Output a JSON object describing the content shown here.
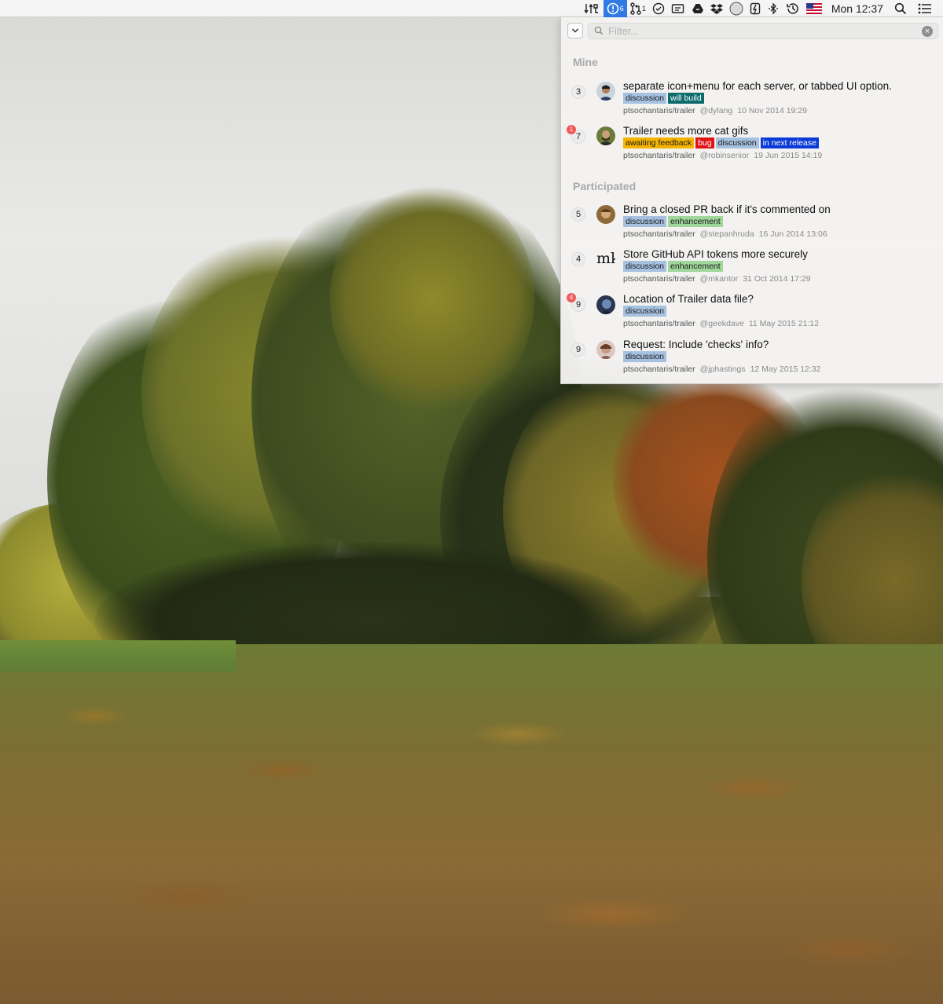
{
  "menubar": {
    "trailer_badge": "6",
    "pr_badge": "1",
    "clock": "Mon 12:37"
  },
  "filter": {
    "placeholder": "Filter..."
  },
  "sections": {
    "mine": "Mine",
    "participated": "Participated"
  },
  "items": [
    {
      "count": "3",
      "unread": "",
      "title": "separate icon+menu for each server, or tabbed UI option.",
      "labels": [
        {
          "text": "discussion",
          "color": "#a6c1e0",
          "fg": "#1b1b1b"
        },
        {
          "text": "will build",
          "color": "#0e6b6b",
          "fg": "#ffffff"
        }
      ],
      "repo": "ptsochantaris/trailer",
      "user": "@dylang",
      "date": "10 Nov 2014 19:29"
    },
    {
      "count": "7",
      "unread": "1",
      "title": "Trailer needs more cat gifs",
      "labels": [
        {
          "text": "awaiting feedback",
          "color": "#f5b400",
          "fg": "#1b1b1b"
        },
        {
          "text": "bug",
          "color": "#e01414",
          "fg": "#ffffff"
        },
        {
          "text": "discussion",
          "color": "#a6c1e0",
          "fg": "#1b1b1b"
        },
        {
          "text": "in next release",
          "color": "#0a3bd6",
          "fg": "#ffffff"
        }
      ],
      "repo": "ptsochantaris/trailer",
      "user": "@robinsenior",
      "date": "19 Jun 2015 14:19"
    },
    {
      "count": "5",
      "unread": "",
      "title": "Bring a closed PR back if it's commented on",
      "labels": [
        {
          "text": "discussion",
          "color": "#a6c1e0",
          "fg": "#1b1b1b"
        },
        {
          "text": "enhancement",
          "color": "#9fd79a",
          "fg": "#1b1b1b"
        }
      ],
      "repo": "ptsochantaris/trailer",
      "user": "@stepanhruda",
      "date": "16 Jun 2014 13:06"
    },
    {
      "count": "4",
      "unread": "",
      "title": "Store GitHub API tokens more securely",
      "labels": [
        {
          "text": "discussion",
          "color": "#a6c1e0",
          "fg": "#1b1b1b"
        },
        {
          "text": "enhancement",
          "color": "#9fd79a",
          "fg": "#1b1b1b"
        }
      ],
      "repo": "ptsochantaris/trailer",
      "user": "@mkantor",
      "date": "31 Oct 2014 17:29"
    },
    {
      "count": "9",
      "unread": "4",
      "title": "Location of Trailer data file?",
      "labels": [
        {
          "text": "discussion",
          "color": "#a6c1e0",
          "fg": "#1b1b1b"
        }
      ],
      "repo": "ptsochantaris/trailer",
      "user": "@geekdave",
      "date": "11 May 2015 21:12"
    },
    {
      "count": "9",
      "unread": "",
      "title": "Request: Include 'checks' info?",
      "labels": [
        {
          "text": "discussion",
          "color": "#a6c1e0",
          "fg": "#1b1b1b"
        }
      ],
      "repo": "ptsochantaris/trailer",
      "user": "@jphastings",
      "date": "12 May 2015 12:32"
    }
  ],
  "avatar_text_mk": "mk"
}
